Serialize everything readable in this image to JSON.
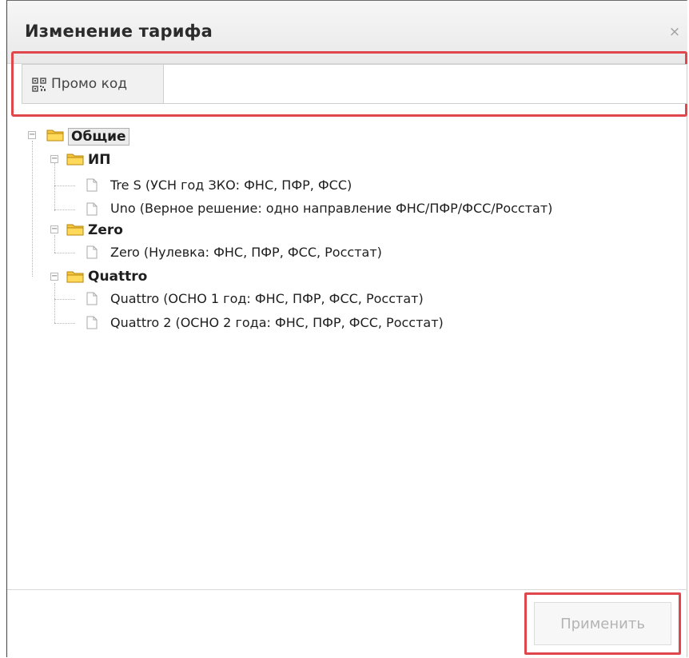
{
  "dialog": {
    "title": "Изменение тарифа",
    "close_glyph": "×",
    "close_icon": "close-icon"
  },
  "promo": {
    "label": "Промо код",
    "icon": "qr-code-icon",
    "value": "",
    "placeholder": ""
  },
  "tree": {
    "root": {
      "label": "Общие",
      "icon": "folder-icon",
      "expanded": true
    },
    "groups": [
      {
        "label": "ИП",
        "expanded": true,
        "items": [
          {
            "label": "Tre S (УСН год ЗКО: ФНС, ПФР, ФСС)"
          },
          {
            "label": "Uno (Верное решение: одно направление ФНС/ПФР/ФСС/Росстат)"
          }
        ]
      },
      {
        "label": "Zero",
        "expanded": true,
        "items": [
          {
            "label": "Zero (Нулевка: ФНС, ПФР, ФСС, Росстат)"
          }
        ]
      },
      {
        "label": "Quattro",
        "expanded": true,
        "items": [
          {
            "label": "Quattro (ОСНО 1 год: ФНС, ПФР, ФСС, Росстат)"
          },
          {
            "label": "Quattro 2 (ОСНО 2 года: ФНС, ПФР, ФСС, Росстат)"
          }
        ]
      }
    ],
    "toggle_glyph": "−"
  },
  "footer": {
    "apply_label": "Применить",
    "apply_disabled": true
  },
  "colors": {
    "highlight": "#e0474c",
    "folder": "#f5c542"
  }
}
